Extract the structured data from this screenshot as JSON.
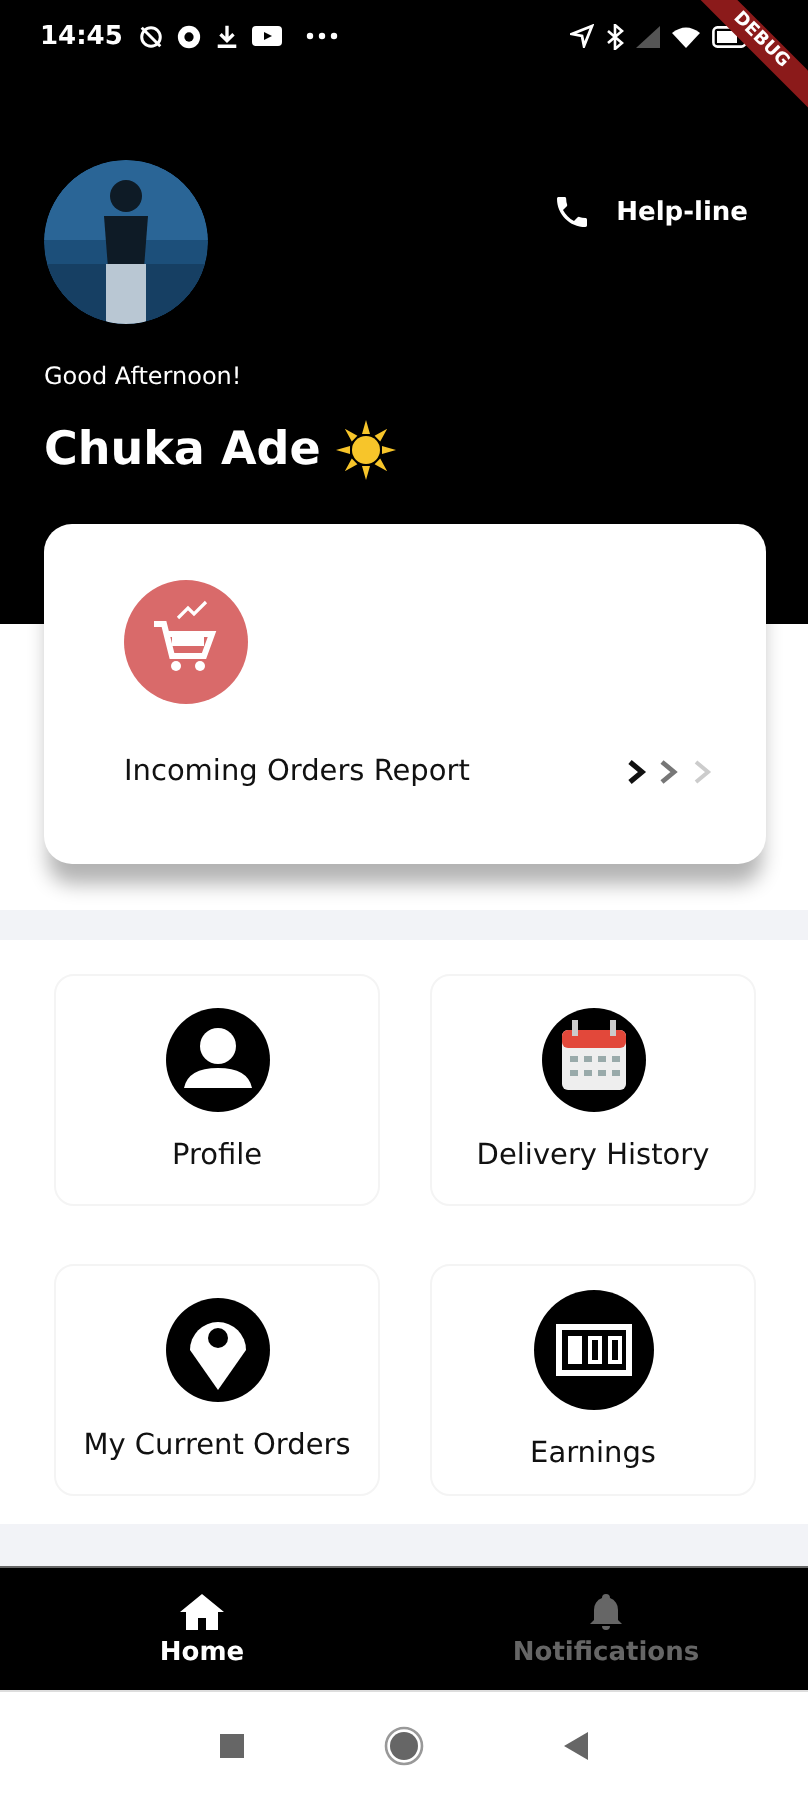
{
  "status_bar": {
    "time": "14:45"
  },
  "debug_banner": "DEBUG",
  "header": {
    "helpline": "Help-line",
    "greeting": "Good Afternoon!",
    "name": "Chuka Ade"
  },
  "report_card": {
    "title": "Incoming Orders Report"
  },
  "menu": [
    {
      "label": "Profile",
      "kind": "profile"
    },
    {
      "label": "Delivery History",
      "kind": "calendar"
    },
    {
      "label": "My Current Orders",
      "kind": "pin"
    },
    {
      "label": "Earnings",
      "kind": "counter"
    }
  ],
  "bottom_nav": [
    {
      "label": "Home",
      "kind": "home",
      "selected": true
    },
    {
      "label": "Notifications",
      "kind": "bell",
      "selected": false
    }
  ]
}
